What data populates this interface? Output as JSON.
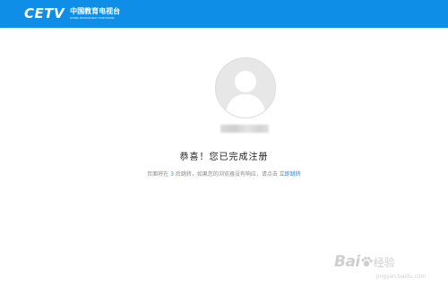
{
  "header": {
    "logo_mark": "CETV",
    "logo_cn": "中国教育电视台",
    "logo_en": "CHINA EDUCATION TELEVISION",
    "background": "#0e8ee7"
  },
  "avatar": {
    "icon": "default-user-avatar-icon"
  },
  "content": {
    "title": "恭喜！您已完成注册",
    "notice_prefix": "页面将在",
    "countdown": "3",
    "notice_middle": "后跳转，如果您的浏览器没有响应，请点击",
    "jump_link": "立即跳转",
    "accent_color": "#2b8be0"
  },
  "watermark": {
    "brand": "Bai",
    "brand_cn": "经验",
    "url": "jingyan.baidu.com"
  }
}
